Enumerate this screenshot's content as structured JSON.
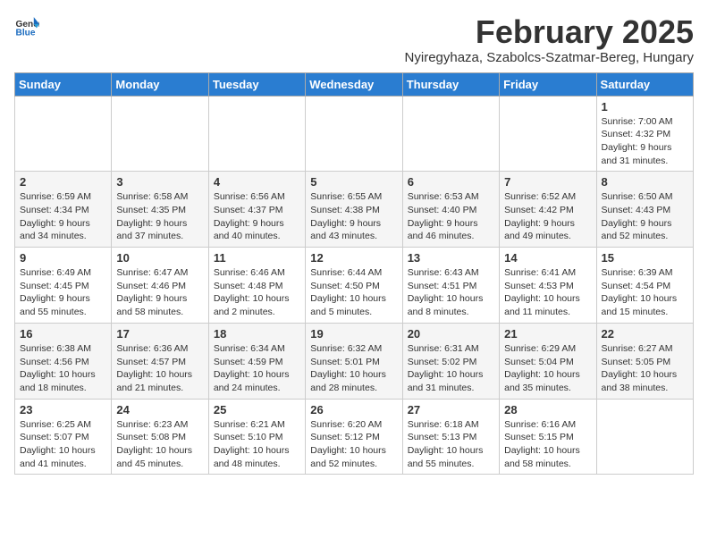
{
  "header": {
    "logo_general": "General",
    "logo_blue": "Blue",
    "month_title": "February 2025",
    "subtitle": "Nyiregyhaza, Szabolcs-Szatmar-Bereg, Hungary"
  },
  "weekdays": [
    "Sunday",
    "Monday",
    "Tuesday",
    "Wednesday",
    "Thursday",
    "Friday",
    "Saturday"
  ],
  "weeks": [
    [
      {
        "day": "",
        "info": ""
      },
      {
        "day": "",
        "info": ""
      },
      {
        "day": "",
        "info": ""
      },
      {
        "day": "",
        "info": ""
      },
      {
        "day": "",
        "info": ""
      },
      {
        "day": "",
        "info": ""
      },
      {
        "day": "1",
        "info": "Sunrise: 7:00 AM\nSunset: 4:32 PM\nDaylight: 9 hours and 31 minutes."
      }
    ],
    [
      {
        "day": "2",
        "info": "Sunrise: 6:59 AM\nSunset: 4:34 PM\nDaylight: 9 hours and 34 minutes."
      },
      {
        "day": "3",
        "info": "Sunrise: 6:58 AM\nSunset: 4:35 PM\nDaylight: 9 hours and 37 minutes."
      },
      {
        "day": "4",
        "info": "Sunrise: 6:56 AM\nSunset: 4:37 PM\nDaylight: 9 hours and 40 minutes."
      },
      {
        "day": "5",
        "info": "Sunrise: 6:55 AM\nSunset: 4:38 PM\nDaylight: 9 hours and 43 minutes."
      },
      {
        "day": "6",
        "info": "Sunrise: 6:53 AM\nSunset: 4:40 PM\nDaylight: 9 hours and 46 minutes."
      },
      {
        "day": "7",
        "info": "Sunrise: 6:52 AM\nSunset: 4:42 PM\nDaylight: 9 hours and 49 minutes."
      },
      {
        "day": "8",
        "info": "Sunrise: 6:50 AM\nSunset: 4:43 PM\nDaylight: 9 hours and 52 minutes."
      }
    ],
    [
      {
        "day": "9",
        "info": "Sunrise: 6:49 AM\nSunset: 4:45 PM\nDaylight: 9 hours and 55 minutes."
      },
      {
        "day": "10",
        "info": "Sunrise: 6:47 AM\nSunset: 4:46 PM\nDaylight: 9 hours and 58 minutes."
      },
      {
        "day": "11",
        "info": "Sunrise: 6:46 AM\nSunset: 4:48 PM\nDaylight: 10 hours and 2 minutes."
      },
      {
        "day": "12",
        "info": "Sunrise: 6:44 AM\nSunset: 4:50 PM\nDaylight: 10 hours and 5 minutes."
      },
      {
        "day": "13",
        "info": "Sunrise: 6:43 AM\nSunset: 4:51 PM\nDaylight: 10 hours and 8 minutes."
      },
      {
        "day": "14",
        "info": "Sunrise: 6:41 AM\nSunset: 4:53 PM\nDaylight: 10 hours and 11 minutes."
      },
      {
        "day": "15",
        "info": "Sunrise: 6:39 AM\nSunset: 4:54 PM\nDaylight: 10 hours and 15 minutes."
      }
    ],
    [
      {
        "day": "16",
        "info": "Sunrise: 6:38 AM\nSunset: 4:56 PM\nDaylight: 10 hours and 18 minutes."
      },
      {
        "day": "17",
        "info": "Sunrise: 6:36 AM\nSunset: 4:57 PM\nDaylight: 10 hours and 21 minutes."
      },
      {
        "day": "18",
        "info": "Sunrise: 6:34 AM\nSunset: 4:59 PM\nDaylight: 10 hours and 24 minutes."
      },
      {
        "day": "19",
        "info": "Sunrise: 6:32 AM\nSunset: 5:01 PM\nDaylight: 10 hours and 28 minutes."
      },
      {
        "day": "20",
        "info": "Sunrise: 6:31 AM\nSunset: 5:02 PM\nDaylight: 10 hours and 31 minutes."
      },
      {
        "day": "21",
        "info": "Sunrise: 6:29 AM\nSunset: 5:04 PM\nDaylight: 10 hours and 35 minutes."
      },
      {
        "day": "22",
        "info": "Sunrise: 6:27 AM\nSunset: 5:05 PM\nDaylight: 10 hours and 38 minutes."
      }
    ],
    [
      {
        "day": "23",
        "info": "Sunrise: 6:25 AM\nSunset: 5:07 PM\nDaylight: 10 hours and 41 minutes."
      },
      {
        "day": "24",
        "info": "Sunrise: 6:23 AM\nSunset: 5:08 PM\nDaylight: 10 hours and 45 minutes."
      },
      {
        "day": "25",
        "info": "Sunrise: 6:21 AM\nSunset: 5:10 PM\nDaylight: 10 hours and 48 minutes."
      },
      {
        "day": "26",
        "info": "Sunrise: 6:20 AM\nSunset: 5:12 PM\nDaylight: 10 hours and 52 minutes."
      },
      {
        "day": "27",
        "info": "Sunrise: 6:18 AM\nSunset: 5:13 PM\nDaylight: 10 hours and 55 minutes."
      },
      {
        "day": "28",
        "info": "Sunrise: 6:16 AM\nSunset: 5:15 PM\nDaylight: 10 hours and 58 minutes."
      },
      {
        "day": "",
        "info": ""
      }
    ]
  ]
}
